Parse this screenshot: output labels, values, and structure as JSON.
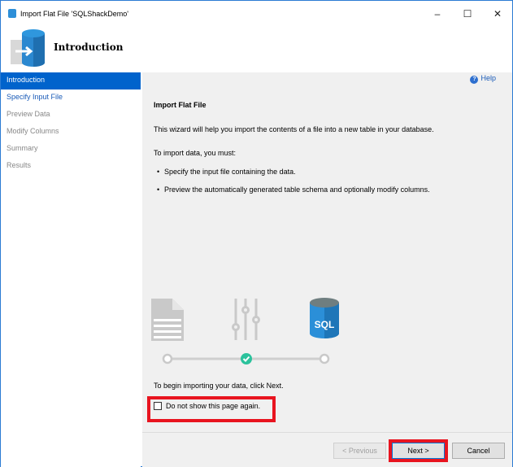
{
  "window": {
    "title": "Import Flat File 'SQLShackDemo'",
    "minimize": "–",
    "maximize": "☐",
    "close": "✕"
  },
  "header": {
    "title": "Introduction"
  },
  "sidebar": {
    "items": [
      {
        "label": "Introduction",
        "state": "active"
      },
      {
        "label": "Specify Input File",
        "state": "link"
      },
      {
        "label": "Preview Data",
        "state": "disabled"
      },
      {
        "label": "Modify Columns",
        "state": "disabled"
      },
      {
        "label": "Summary",
        "state": "disabled"
      },
      {
        "label": "Results",
        "state": "disabled"
      }
    ]
  },
  "content": {
    "help": "Help",
    "title": "Import Flat File",
    "intro": "This wizard will help you import the contents of a file into a new table in your database.",
    "must": "To import data, you must:",
    "bullets": [
      "Specify the input file containing the data.",
      "Preview the automatically generated table schema and optionally modify columns."
    ],
    "sql_label": "SQL",
    "begin": "To begin importing your data, click Next.",
    "checkbox_label": "Do not show this page again.",
    "checkbox_checked": false
  },
  "footer": {
    "previous": "< Previous",
    "next": "Next >",
    "cancel": "Cancel"
  },
  "colors": {
    "accent": "#0063cc",
    "highlight": "#e8141f",
    "check": "#2bc29c"
  }
}
